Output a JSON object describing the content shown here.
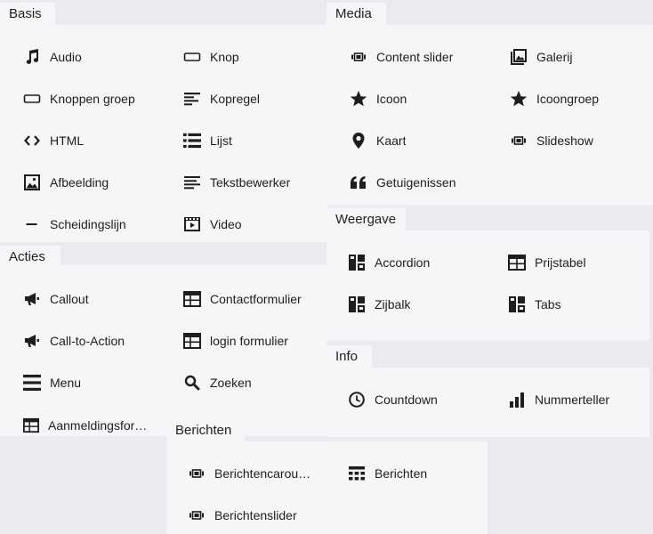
{
  "groups": {
    "basis": {
      "title": "Basis",
      "items": [
        "Audio",
        "Knop",
        "Knoppen groep",
        "Kopregel",
        "HTML",
        "Lijst",
        "Afbeelding",
        "Tekstbewerker",
        "Scheidingslijn",
        "Video"
      ],
      "icons": [
        "music-note-icon",
        "button-icon",
        "button-group-icon",
        "heading-icon",
        "code-icon",
        "list-icon",
        "image-icon",
        "text-editor-icon",
        "divider-icon",
        "video-icon"
      ]
    },
    "media": {
      "title": "Media",
      "items": [
        "Content slider",
        "Galerij",
        "Icoon",
        "Icoongroep",
        "Kaart",
        "Slideshow",
        "Getuigenissen"
      ],
      "icons": [
        "slider-icon",
        "gallery-icon",
        "star-icon",
        "star-icon",
        "map-marker-icon",
        "slideshow-icon",
        "quote-icon"
      ]
    },
    "weergave": {
      "title": "Weergave",
      "items": [
        "Accordion",
        "Prijstabel",
        "Zijbalk",
        "Tabs"
      ],
      "icons": [
        "layout-icon",
        "table-icon",
        "layout-icon",
        "layout-icon"
      ]
    },
    "acties": {
      "title": "Acties",
      "items": [
        "Callout",
        "Contactformulier",
        "Call-to-Action",
        "login formulier",
        "Menu",
        "Zoeken",
        "Aanmeldingsfor…"
      ],
      "icons": [
        "megaphone-icon",
        "form-icon",
        "megaphone-icon",
        "form-icon",
        "menu-icon",
        "search-icon",
        "form-icon"
      ]
    },
    "info": {
      "title": "Info",
      "items": [
        "Countdown",
        "Nummerteller"
      ],
      "icons": [
        "clock-icon",
        "bar-chart-icon"
      ]
    },
    "berichten": {
      "title": "Berichten",
      "items": [
        "Berichtencarou…",
        "Berichten",
        "Berichtenslider"
      ],
      "icons": [
        "slider-icon",
        "posts-grid-icon",
        "slider-icon"
      ]
    }
  }
}
